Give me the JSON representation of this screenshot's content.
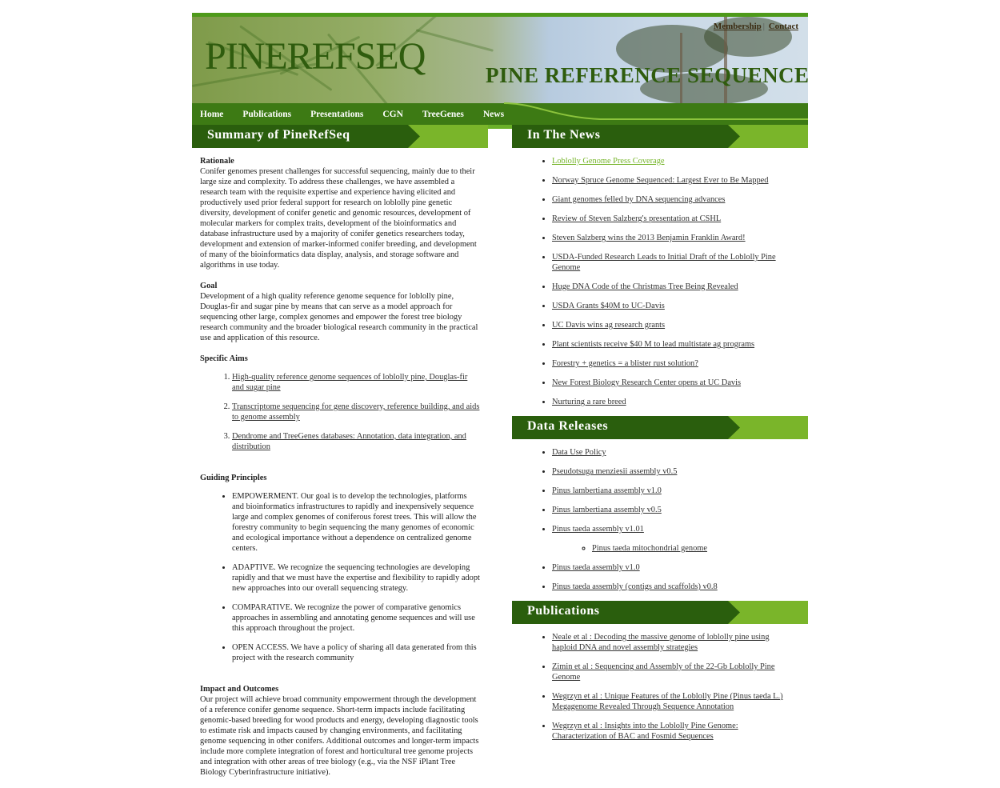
{
  "header": {
    "site_title": "PINEREFSEQ",
    "site_subtitle": "PINE REFERENCE SEQUENCES",
    "toplinks": [
      "Membership",
      "Contact"
    ],
    "toplinks_separator": "|"
  },
  "nav": [
    "Home",
    "Publications",
    "Presentations",
    "CGN",
    "TreeGenes",
    "News"
  ],
  "summary": {
    "heading": "Summary of PineRefSeq",
    "rationale_title": "Rationale",
    "rationale_text": "Conifer genomes present challenges for successful sequencing, mainly due to their large size and complexity. To address these challenges, we have assembled a research team with the requisite expertise and experience having elicited and productively used prior federal support for research on loblolly pine genetic diversity, development of conifer genetic and genomic resources, development of molecular markers for complex traits, development of the bioinformatics and database infrastructure used by a majority of conifer genetics researchers today, development and extension of marker-informed conifer breeding, and development of many of the bioinformatics data display, analysis, and storage software and algorithms in use today.",
    "goal_title": "Goal",
    "goal_text": "Development of a high quality reference genome sequence for loblolly pine, Douglas-fir and sugar pine by means that can serve as a model approach for sequencing other large, complex genomes and empower the forest tree biology research community and the broader biological research community in the practical use and application of this resource.",
    "aims_title": "Specific Aims",
    "aims": [
      "High-quality reference genome sequences of loblolly pine, Douglas-fir and sugar pine",
      "Transcriptome sequencing for gene discovery, reference building, and aids to genome assembly",
      "Dendrome and TreeGenes databases: Annotation, data integration, and distribution"
    ],
    "principles_title": "Guiding Principles",
    "principles": [
      "EMPOWERMENT. Our goal is to develop the technologies, platforms and bioinformatics infrastructures to rapidly and inexpensively sequence large and complex genomes of coniferous forest trees. This will allow the forestry community to begin sequencing the many genomes of economic and ecological importance without a dependence on centralized genome centers.",
      "ADAPTIVE. We recognize the sequencing technologies are developing rapidly and that we must have the expertise and flexibility to rapidly adopt new approaches into our overall sequencing strategy.",
      "COMPARATIVE. We recognize the power of comparative genomics approaches in assembling and annotating genome sequences and will use this approach throughout the project.",
      "OPEN ACCESS. We have a policy of sharing all data generated from this project with the research community"
    ],
    "impact_title": "Impact and Outcomes",
    "impact_text": "Our project will achieve broad community empowerment through the development of a reference conifer genome sequence. Short-term impacts include facilitating genomic-based breeding for wood products and energy, developing diagnostic tools to estimate risk and impacts caused by changing environments, and facilitating genome sequencing in other conifers. Additional outcomes and longer-term impacts include more complete integration of forest and horticultural tree genome projects and integration with other areas of tree biology (e.g., via the NSF iPlant Tree Biology Cyberinfrastructure initiative)."
  },
  "news": {
    "heading": "In The News",
    "items": [
      "Loblolly Genome Press Coverage",
      "Norway Spruce Genome Sequenced: Largest Ever to Be Mapped",
      "Giant genomes felled by DNA sequencing advances",
      "Review of Steven Salzberg's presentation at CSHL",
      "Steven Salzberg wins the 2013 Benjamin Franklin Award!",
      "USDA-Funded Research Leads to Initial Draft of the Loblolly Pine Genome",
      "Huge DNA Code of the Christmas Tree Being Revealed",
      "USDA Grants $40M to UC-Davis",
      "UC Davis wins ag research grants",
      "Plant scientists receive $40 M to lead multistate ag programs",
      "Forestry + genetics = a blister rust solution?",
      "New Forest Biology Research Center opens at UC Davis",
      "Nurturing a rare breed"
    ]
  },
  "releases": {
    "heading": "Data Releases",
    "items": [
      "Data Use Policy",
      "Pseudotsuga menziesii assembly v0.5",
      "Pinus lambertiana assembly v1.0",
      "Pinus lambertiana assembly v0.5",
      "Pinus taeda assembly v1.01",
      "Pinus taeda assembly v1.0",
      "Pinus taeda assembly (contigs and scaffolds) v0.8"
    ],
    "sub_item": "Pinus taeda mitochondrial genome"
  },
  "publications": {
    "heading": "Publications",
    "items": [
      "Neale et al : Decoding the massive genome of loblolly pine using haploid DNA and novel assembly strategies",
      "Zimin et al : Sequencing and Assembly of the 22-Gb Loblolly Pine Genome",
      "Wegrzyn et al : Unique Features of the Loblolly Pine (Pinus taeda L.) Megagenome Revealed Through Sequence Annotation",
      "Wegrzyn et al : Insights into the Loblolly Pine Genome: Characterization of BAC and Fosmid Sequences"
    ]
  }
}
